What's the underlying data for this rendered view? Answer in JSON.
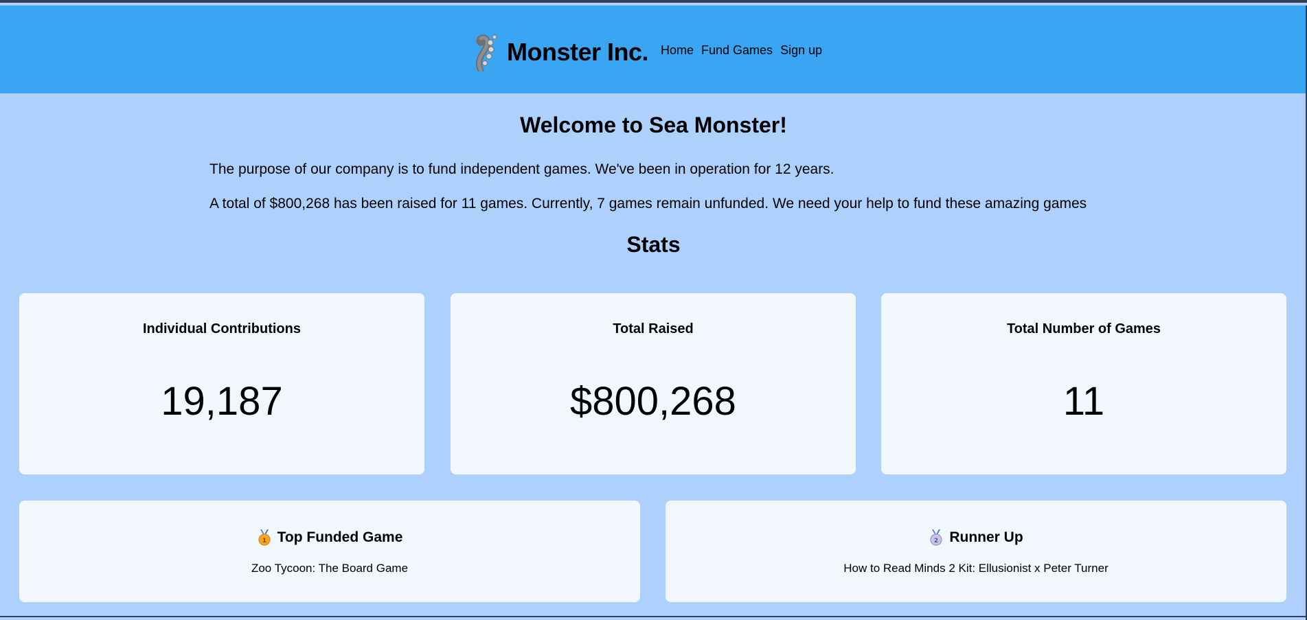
{
  "header": {
    "brand_title": "Monster Inc.",
    "logo_icon": "sea-monster-tentacle-icon",
    "nav": {
      "home": "Home",
      "fund_games": "Fund Games",
      "sign_up": "Sign up"
    }
  },
  "main": {
    "welcome_title": "Welcome to Sea Monster!",
    "purpose_text": "The purpose of our company is to fund independent games. We've been in operation for 12 years.",
    "summary_text": "A total of $800,268 has been raised for 11 games. Currently, 7 games remain unfunded. We need your help to fund these amazing games",
    "stats_title": "Stats"
  },
  "stats": [
    {
      "label": "Individual Contributions",
      "value": "19,187"
    },
    {
      "label": "Total Raised",
      "value": "$800,268"
    },
    {
      "label": "Total Number of Games",
      "value": "11"
    }
  ],
  "top_games": [
    {
      "title": "Top Funded Game",
      "game": "Zoo Tycoon: The Board Game",
      "icon": "gold-medal-icon"
    },
    {
      "title": "Runner Up",
      "game": "How to Read Minds 2 Kit: Ellusionist x Peter Turner",
      "icon": "silver-medal-icon"
    }
  ],
  "colors": {
    "header_bg": "#3aa5f2",
    "page_bg": "#aed0fd",
    "card_bg": "#f2f7fe",
    "frame": "#2f4156"
  }
}
